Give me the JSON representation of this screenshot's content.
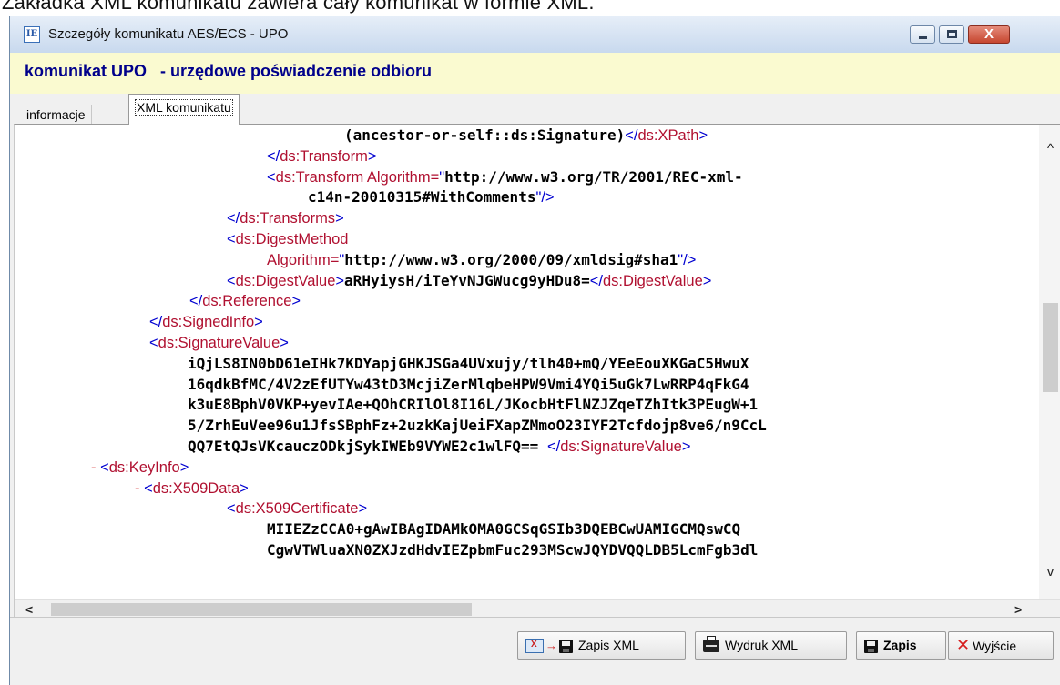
{
  "page_top_text": "Zakładka XML komunikatu zawiera cały komunikat w formie XML.",
  "window": {
    "icon_text": "IE",
    "title": "Szczegóły komunikatu AES/ECS - UPO",
    "controls": {
      "minimize": "minimize",
      "maximize": "maximize",
      "close": "X"
    }
  },
  "heading": "komunikat UPO   - urzędowe poświadczenie odbioru",
  "tabs": [
    {
      "label": "informacje",
      "active": false
    },
    {
      "label": "XML komunikatu",
      "active": true
    }
  ],
  "xml_lines": [
    {
      "t": "(ancestor-or-self::ds:Signature)",
      "k": "val",
      "after": "</ds:XPath>"
    },
    {
      "t": "</ds:Transform>"
    },
    {
      "t": "<ds:Transform Algorithm=",
      "q": "\"",
      "v": "http://www.w3.org/TR/2001/REC-xml-"
    },
    {
      "v": "c14n-20010315#WithComments",
      "q": "\"",
      "after": "/>"
    },
    {
      "t": "</ds:Transforms>"
    },
    {
      "t": "<ds:DigestMethod"
    },
    {
      "t": "Algorithm=",
      "q": "\"",
      "v": "http://www.w3.org/2000/09/xmldsig#sha1",
      "q2": "\"",
      "after": "/>"
    },
    {
      "t": "<ds:DigestValue>",
      "v": "aRHyiysH/iTeYvNJGWucg9yHDu8=",
      "after": "</ds:DigestValue>"
    },
    {
      "t": "</ds:Reference>"
    },
    {
      "t": "</ds:SignedInfo>"
    },
    {
      "t": "<ds:SignatureValue>"
    },
    {
      "v": "iQjLS8IN0bD61eIHk7KDYapjGHKJSGa4UVxujy/tlh40+mQ/YEeEouXKGaC5HwuX"
    },
    {
      "v": "16qdkBfMC/4V2zEfUTYw43tD3McjiZerMlqbeHPW9Vmi4YQi5uGk7LwRRP4qFkG4"
    },
    {
      "v": "k3uE8BphV0VKP+yevIAe+QOhCRIlOl8I16L/JKocbHtFlNZJZqeTZhItk3PEugW+1"
    },
    {
      "v": "5/ZrhEuVee96u1JfsSBphFz+2uzkKajUeiFXapZMmoO23IYF2Tcfdojp8ve6/n9CcL"
    },
    {
      "v": "QQ7EtQJsVKcauczODkjSykIWEb9VYWE2c1wlFQ== ",
      "after": "</ds:SignatureValue>"
    },
    {
      "m": "- ",
      "t": "<ds:KeyInfo>"
    },
    {
      "m": "- ",
      "t": "<ds:X509Data>"
    },
    {
      "t": "<ds:X509Certificate>"
    },
    {
      "v": "MIIEZzCCA0+gAwIBAgIDAMkOMA0GCSqGSIb3DQEBCwUAMIGCMQswCQ"
    },
    {
      "v": "CgwVTWluaXN0ZXJzdHdvIEZpbmFuc293MScwJQYDVQQLDB5LcmFgb3dl"
    }
  ],
  "footer": {
    "zapis_xml": "Zapis XML",
    "wydruk_xml": "Wydruk XML",
    "zapis": "Zapis",
    "wyjscie": "Wyjście"
  },
  "colors": {
    "tag": "#b01030",
    "bracket": "#0000d0",
    "heading": "#00008b",
    "heading_bg": "#fafad0"
  }
}
